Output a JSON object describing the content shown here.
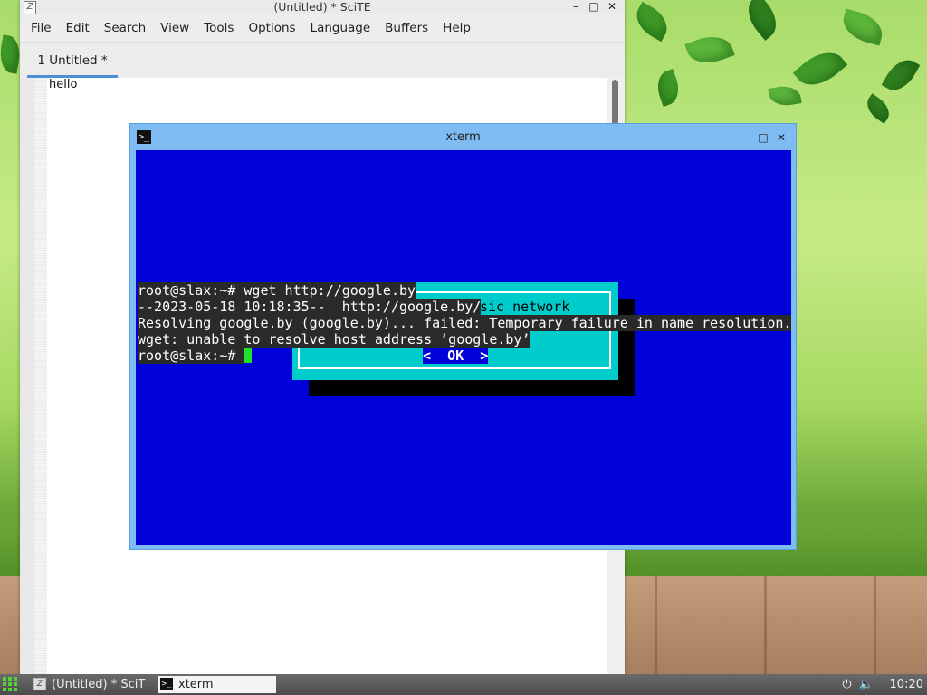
{
  "scite": {
    "title": "(Untitled) * SciTE",
    "app_icon": "Z",
    "menu": [
      "File",
      "Edit",
      "Search",
      "View",
      "Tools",
      "Options",
      "Language",
      "Buffers",
      "Help"
    ],
    "tab_label": "1 Untitled *",
    "editor_text": "hello",
    "controls": {
      "minimize": "–",
      "maximize": "□",
      "close": "✕"
    }
  },
  "xterm": {
    "title": "xterm",
    "icon_glyph": ">_",
    "controls": {
      "minimize": "–",
      "maximize": "□",
      "close": "✕"
    },
    "dialog_fragment": "sic network",
    "dialog_button": "<  OK  >",
    "lines": [
      "root@slax:~# wget http://google.by",
      "--2023-05-18 10:18:35--  http://google.by/",
      "Resolving google.by (google.by)... failed: Temporary failure in name resolution.",
      "wget: unable to resolve host address ‘google.by’",
      "root@slax:~# "
    ]
  },
  "taskbar": {
    "tasks": [
      {
        "label": "(Untitled) * SciT",
        "icon": "scite-icon",
        "active": false
      },
      {
        "label": "xterm",
        "icon": "terminal-icon",
        "active": true
      }
    ],
    "tray_icons": [
      "power-icon",
      "volume-icon"
    ],
    "clock": "10:20"
  },
  "colors": {
    "terminal_bg": "#0000d8",
    "dialog_bg": "#00cccc",
    "cursor": "#22e02a",
    "xterm_frame": "#7fbcf3",
    "tab_accent": "#4a90d9"
  }
}
